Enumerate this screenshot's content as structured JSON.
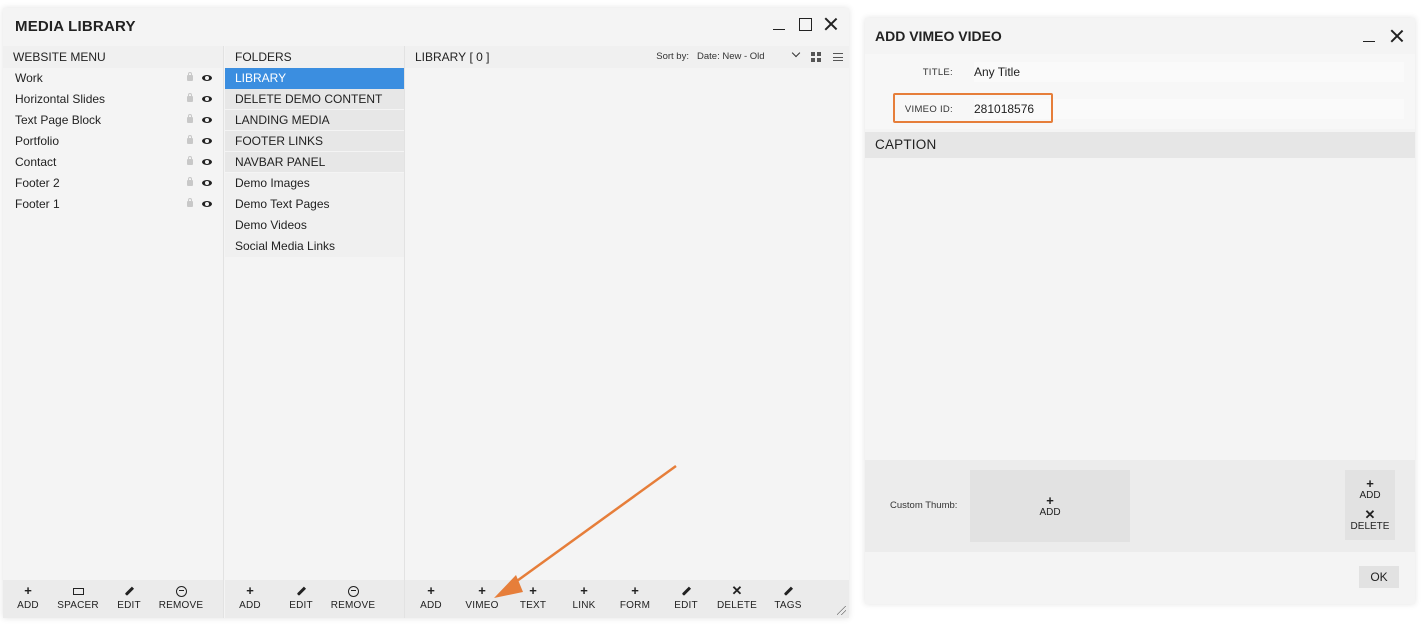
{
  "media_library": {
    "title": "MEDIA LIBRARY",
    "website_menu": {
      "heading": "WEBSITE MENU",
      "items": [
        "Work",
        "Horizontal Slides",
        "Text Page Block",
        "Portfolio",
        "Contact",
        "Footer 2",
        "Footer 1"
      ],
      "toolbar": {
        "add": "ADD",
        "spacer": "SPACER",
        "edit": "EDIT",
        "remove": "REMOVE"
      }
    },
    "folders": {
      "heading": "FOLDERS",
      "items": [
        "LIBRARY",
        "DELETE DEMO CONTENT",
        "LANDING MEDIA",
        "FOOTER LINKS",
        "NAVBAR PANEL",
        "Demo Images",
        "Demo Text Pages",
        "Demo Videos",
        "Social Media Links"
      ],
      "toolbar": {
        "add": "ADD",
        "edit": "EDIT",
        "remove": "REMOVE"
      }
    },
    "library": {
      "heading": "LIBRARY",
      "count": "[ 0 ]",
      "sort_label": "Sort by:",
      "sort_value": "Date: New - Old",
      "toolbar": {
        "add": "ADD",
        "vimeo": "VIMEO",
        "text": "TEXT",
        "link": "LINK",
        "form": "FORM",
        "edit": "EDIT",
        "delete": "DELETE",
        "tags": "TAGS"
      }
    }
  },
  "vimeo_dialog": {
    "title": "ADD VIMEO VIDEO",
    "title_label": "TITLE:",
    "title_value": "Any Title",
    "vimeo_id_label": "VIMEO ID:",
    "vimeo_id_value": "281018576",
    "caption_heading": "CAPTION",
    "custom_thumb_label": "Custom Thumb:",
    "thumb_add": "ADD",
    "side_add": "ADD",
    "side_delete": "DELETE",
    "ok": "OK"
  },
  "colors": {
    "accent": "#3b8ee0",
    "highlight": "#e67e3a"
  }
}
